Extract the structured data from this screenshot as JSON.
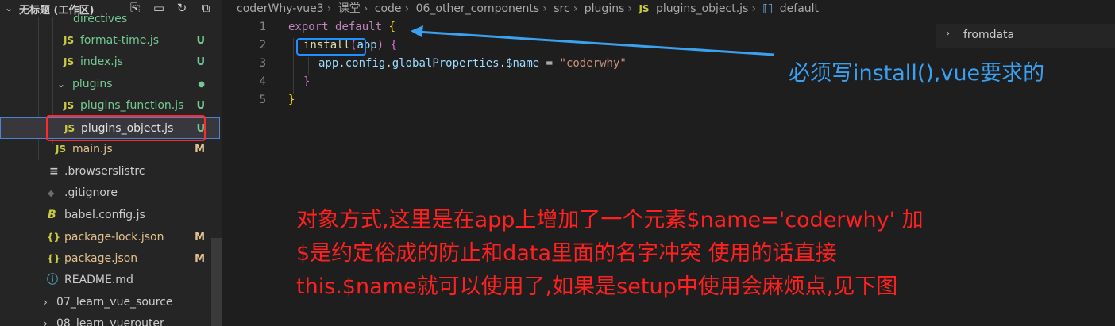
{
  "sidebar": {
    "workspace_title": "无标题 (工作区)",
    "items": [
      {
        "label": "directives",
        "icon": "",
        "badge": "",
        "color": "#73c991"
      },
      {
        "label": "format-time.js",
        "icon": "JS",
        "badge": "U",
        "color": "#73c991"
      },
      {
        "label": "index.js",
        "icon": "JS",
        "badge": "U",
        "color": "#73c991"
      },
      {
        "label": "plugins",
        "icon": "",
        "badge": "●",
        "color": "#73c991"
      },
      {
        "label": "plugins_function.js",
        "icon": "JS",
        "badge": "U",
        "color": "#73c991"
      },
      {
        "label": "plugins_object.js",
        "icon": "JS",
        "badge": "U",
        "color": "#e2e2e2"
      },
      {
        "label": "main.js",
        "icon": "JS",
        "badge": "M",
        "color": "#e2c08d"
      },
      {
        "label": ".browserslistrc",
        "icon": "≡",
        "badge": "",
        "color": "#cccccc"
      },
      {
        "label": ".gitignore",
        "icon": "◆",
        "badge": "",
        "color": "#cccccc"
      },
      {
        "label": "babel.config.js",
        "icon": "B",
        "badge": "",
        "color": "#cccccc"
      },
      {
        "label": "package-lock.json",
        "icon": "{}",
        "badge": "M",
        "color": "#e2c08d"
      },
      {
        "label": "package.json",
        "icon": "{}",
        "badge": "M",
        "color": "#e2c08d"
      },
      {
        "label": "README.md",
        "icon": "ⓘ",
        "badge": "",
        "color": "#cccccc"
      },
      {
        "label": "07_learn_vue_source",
        "icon": "",
        "badge": "",
        "color": "#cccccc"
      },
      {
        "label": "08_learn_vuerouter",
        "icon": "",
        "badge": "",
        "color": "#cccccc"
      }
    ]
  },
  "breadcrumb": {
    "parts": [
      "coderWhy-vue3",
      "课堂",
      "code",
      "06_other_components",
      "src",
      "plugins"
    ],
    "file_icon": "JS",
    "file": "plugins_object.js",
    "symbol": "default"
  },
  "code": {
    "line_numbers": [
      "1",
      "2",
      "3",
      "4",
      "5"
    ],
    "l1": {
      "kw1": "export",
      "kw2": "default",
      "brace": "{"
    },
    "l2": {
      "fn": "install",
      "paren_open": "(",
      "param": "app",
      "paren_close": ")",
      "brace": "{"
    },
    "l3": {
      "obj": "app",
      "p1": "config",
      "p2": "globalProperties",
      "p3": "$name",
      "eq": "=",
      "str": "\"coderwhy\""
    },
    "l4": {
      "brace": "}"
    },
    "l5": {
      "brace": "}"
    }
  },
  "outline": {
    "label": "fromdata"
  },
  "annotations": {
    "blue": "必须写install(),vue要求的",
    "red_line1": "对象方式,这里是在app上增加了一个元素$name='coderwhy' 加",
    "red_line2": "$是约定俗成的防止和data里面的名字冲突 使用的话直接",
    "red_line3": "this.$name就可以使用了,如果是setup中使用会麻烦点,见下图"
  },
  "colors": {
    "annotation_blue": "#3aa0f0",
    "annotation_red": "#ff2020",
    "highlight_red_box": "#ff2a2a"
  }
}
